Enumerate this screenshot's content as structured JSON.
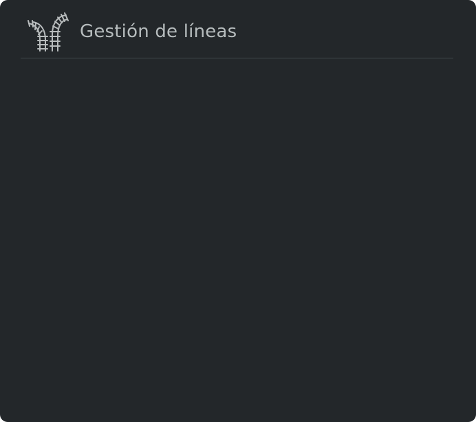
{
  "header": {
    "title": "Gestión de líneas",
    "icon": "railway-junction-icon"
  },
  "colors": {
    "panel_background": "#23272a",
    "title_text": "#b6bcbd",
    "divider": "#42494d",
    "icon_stroke": "#b8bcbd"
  }
}
